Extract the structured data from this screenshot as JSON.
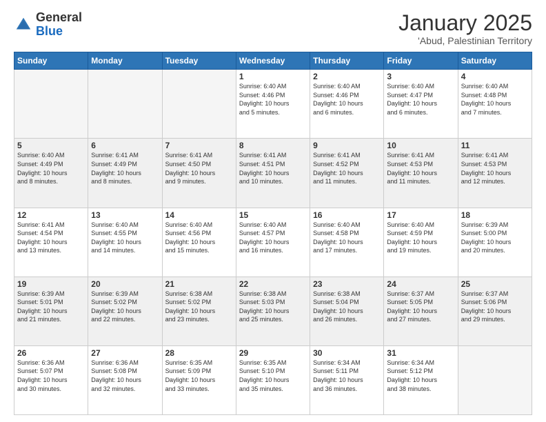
{
  "logo": {
    "general": "General",
    "blue": "Blue"
  },
  "title": "January 2025",
  "subtitle": "'Abud, Palestinian Territory",
  "days_header": [
    "Sunday",
    "Monday",
    "Tuesday",
    "Wednesday",
    "Thursday",
    "Friday",
    "Saturday"
  ],
  "weeks": [
    {
      "shade": false,
      "days": [
        {
          "num": "",
          "info": "",
          "empty": true
        },
        {
          "num": "",
          "info": "",
          "empty": true
        },
        {
          "num": "",
          "info": "",
          "empty": true
        },
        {
          "num": "1",
          "info": "Sunrise: 6:40 AM\nSunset: 4:46 PM\nDaylight: 10 hours\nand 5 minutes.",
          "empty": false
        },
        {
          "num": "2",
          "info": "Sunrise: 6:40 AM\nSunset: 4:46 PM\nDaylight: 10 hours\nand 6 minutes.",
          "empty": false
        },
        {
          "num": "3",
          "info": "Sunrise: 6:40 AM\nSunset: 4:47 PM\nDaylight: 10 hours\nand 6 minutes.",
          "empty": false
        },
        {
          "num": "4",
          "info": "Sunrise: 6:40 AM\nSunset: 4:48 PM\nDaylight: 10 hours\nand 7 minutes.",
          "empty": false
        }
      ]
    },
    {
      "shade": true,
      "days": [
        {
          "num": "5",
          "info": "Sunrise: 6:40 AM\nSunset: 4:49 PM\nDaylight: 10 hours\nand 8 minutes.",
          "empty": false
        },
        {
          "num": "6",
          "info": "Sunrise: 6:41 AM\nSunset: 4:49 PM\nDaylight: 10 hours\nand 8 minutes.",
          "empty": false
        },
        {
          "num": "7",
          "info": "Sunrise: 6:41 AM\nSunset: 4:50 PM\nDaylight: 10 hours\nand 9 minutes.",
          "empty": false
        },
        {
          "num": "8",
          "info": "Sunrise: 6:41 AM\nSunset: 4:51 PM\nDaylight: 10 hours\nand 10 minutes.",
          "empty": false
        },
        {
          "num": "9",
          "info": "Sunrise: 6:41 AM\nSunset: 4:52 PM\nDaylight: 10 hours\nand 11 minutes.",
          "empty": false
        },
        {
          "num": "10",
          "info": "Sunrise: 6:41 AM\nSunset: 4:53 PM\nDaylight: 10 hours\nand 11 minutes.",
          "empty": false
        },
        {
          "num": "11",
          "info": "Sunrise: 6:41 AM\nSunset: 4:53 PM\nDaylight: 10 hours\nand 12 minutes.",
          "empty": false
        }
      ]
    },
    {
      "shade": false,
      "days": [
        {
          "num": "12",
          "info": "Sunrise: 6:41 AM\nSunset: 4:54 PM\nDaylight: 10 hours\nand 13 minutes.",
          "empty": false
        },
        {
          "num": "13",
          "info": "Sunrise: 6:40 AM\nSunset: 4:55 PM\nDaylight: 10 hours\nand 14 minutes.",
          "empty": false
        },
        {
          "num": "14",
          "info": "Sunrise: 6:40 AM\nSunset: 4:56 PM\nDaylight: 10 hours\nand 15 minutes.",
          "empty": false
        },
        {
          "num": "15",
          "info": "Sunrise: 6:40 AM\nSunset: 4:57 PM\nDaylight: 10 hours\nand 16 minutes.",
          "empty": false
        },
        {
          "num": "16",
          "info": "Sunrise: 6:40 AM\nSunset: 4:58 PM\nDaylight: 10 hours\nand 17 minutes.",
          "empty": false
        },
        {
          "num": "17",
          "info": "Sunrise: 6:40 AM\nSunset: 4:59 PM\nDaylight: 10 hours\nand 19 minutes.",
          "empty": false
        },
        {
          "num": "18",
          "info": "Sunrise: 6:39 AM\nSunset: 5:00 PM\nDaylight: 10 hours\nand 20 minutes.",
          "empty": false
        }
      ]
    },
    {
      "shade": true,
      "days": [
        {
          "num": "19",
          "info": "Sunrise: 6:39 AM\nSunset: 5:01 PM\nDaylight: 10 hours\nand 21 minutes.",
          "empty": false
        },
        {
          "num": "20",
          "info": "Sunrise: 6:39 AM\nSunset: 5:02 PM\nDaylight: 10 hours\nand 22 minutes.",
          "empty": false
        },
        {
          "num": "21",
          "info": "Sunrise: 6:38 AM\nSunset: 5:02 PM\nDaylight: 10 hours\nand 23 minutes.",
          "empty": false
        },
        {
          "num": "22",
          "info": "Sunrise: 6:38 AM\nSunset: 5:03 PM\nDaylight: 10 hours\nand 25 minutes.",
          "empty": false
        },
        {
          "num": "23",
          "info": "Sunrise: 6:38 AM\nSunset: 5:04 PM\nDaylight: 10 hours\nand 26 minutes.",
          "empty": false
        },
        {
          "num": "24",
          "info": "Sunrise: 6:37 AM\nSunset: 5:05 PM\nDaylight: 10 hours\nand 27 minutes.",
          "empty": false
        },
        {
          "num": "25",
          "info": "Sunrise: 6:37 AM\nSunset: 5:06 PM\nDaylight: 10 hours\nand 29 minutes.",
          "empty": false
        }
      ]
    },
    {
      "shade": false,
      "days": [
        {
          "num": "26",
          "info": "Sunrise: 6:36 AM\nSunset: 5:07 PM\nDaylight: 10 hours\nand 30 minutes.",
          "empty": false
        },
        {
          "num": "27",
          "info": "Sunrise: 6:36 AM\nSunset: 5:08 PM\nDaylight: 10 hours\nand 32 minutes.",
          "empty": false
        },
        {
          "num": "28",
          "info": "Sunrise: 6:35 AM\nSunset: 5:09 PM\nDaylight: 10 hours\nand 33 minutes.",
          "empty": false
        },
        {
          "num": "29",
          "info": "Sunrise: 6:35 AM\nSunset: 5:10 PM\nDaylight: 10 hours\nand 35 minutes.",
          "empty": false
        },
        {
          "num": "30",
          "info": "Sunrise: 6:34 AM\nSunset: 5:11 PM\nDaylight: 10 hours\nand 36 minutes.",
          "empty": false
        },
        {
          "num": "31",
          "info": "Sunrise: 6:34 AM\nSunset: 5:12 PM\nDaylight: 10 hours\nand 38 minutes.",
          "empty": false
        },
        {
          "num": "",
          "info": "",
          "empty": true
        }
      ]
    }
  ]
}
